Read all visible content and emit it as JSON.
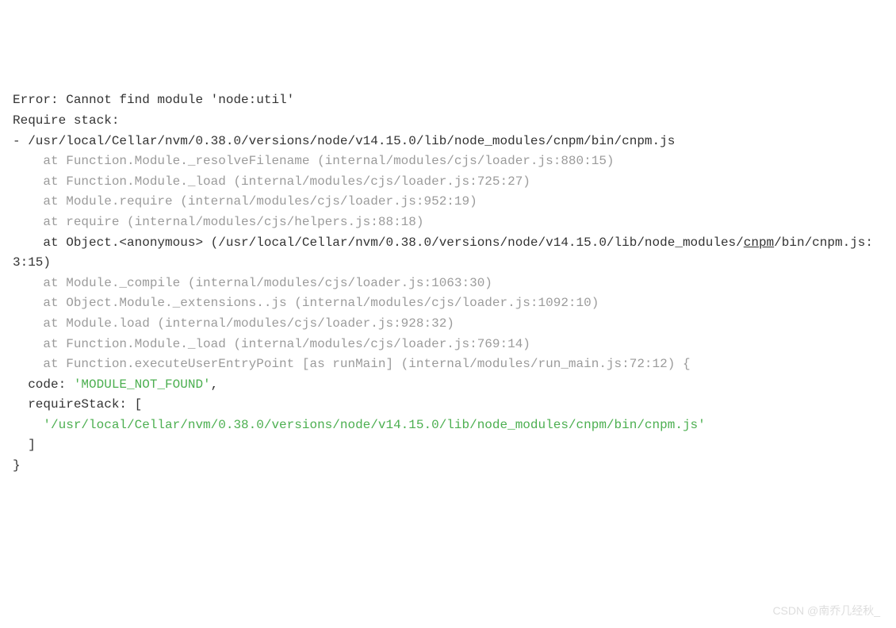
{
  "error": {
    "title": "Error: Cannot find module 'node:util'",
    "require_stack_label": "Require stack:",
    "require_path": "- /usr/local/Cellar/nvm/0.38.0/versions/node/v14.15.0/lib/node_modules/cnpm/bin/cnpm.js",
    "stack": [
      "    at Function.Module._resolveFilename (internal/modules/cjs/loader.js:880:15)",
      "    at Function.Module._load (internal/modules/cjs/loader.js:725:27)",
      "    at Module.require (internal/modules/cjs/loader.js:952:19)",
      "    at require (internal/modules/cjs/helpers.js:88:18)"
    ],
    "anonymous_prefix": "    at Object.<anonymous> (/usr/local/Cellar/nvm/0.38.0/versions/node/v14.15.0/lib/node_modules/",
    "anonymous_underlined": "cnpm",
    "anonymous_suffix": "/bin/cnpm.js:3:15)",
    "stack2": [
      "    at Module._compile (internal/modules/cjs/loader.js:1063:30)",
      "    at Object.Module._extensions..js (internal/modules/cjs/loader.js:1092:10)",
      "    at Module.load (internal/modules/cjs/loader.js:928:32)",
      "    at Function.Module._load (internal/modules/cjs/loader.js:769:14)",
      "    at Function.executeUserEntryPoint [as runMain] (internal/modules/run_main.js:72:12) {"
    ],
    "code_label": "  code: ",
    "code_value": "'MODULE_NOT_FOUND'",
    "code_comma": ",",
    "require_stack_prop": "  requireStack: [",
    "require_stack_value": "    '/usr/local/Cellar/nvm/0.38.0/versions/node/v14.15.0/lib/node_modules/cnpm/bin/cnpm.js'",
    "closing_bracket": "  ]",
    "closing_brace": "}"
  },
  "watermark": "CSDN @南乔几经秋_"
}
